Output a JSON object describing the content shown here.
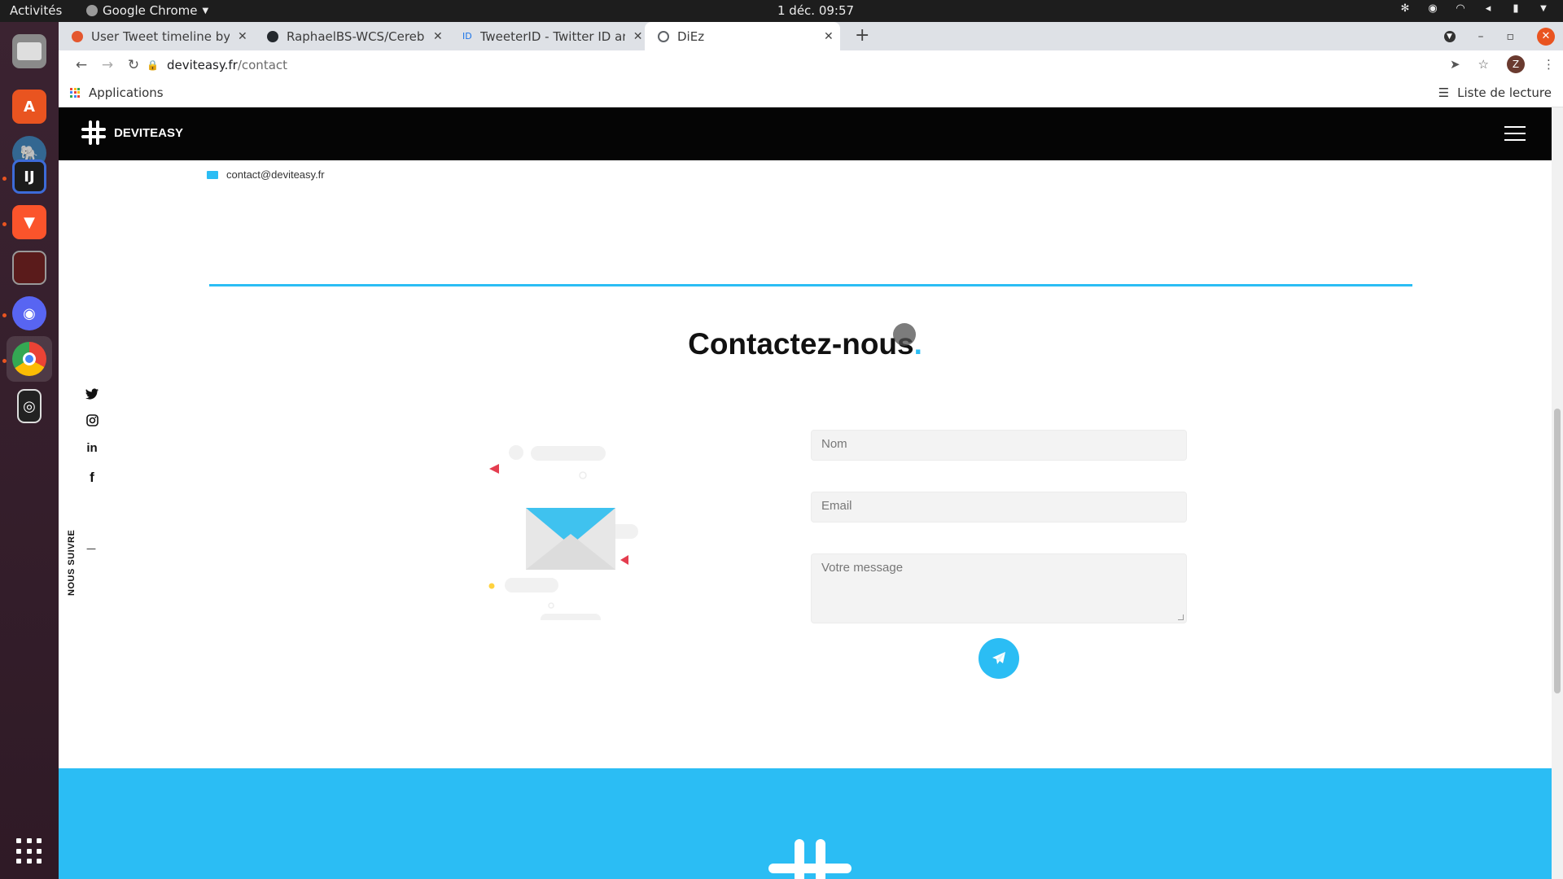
{
  "topbar": {
    "activities": "Activités",
    "app_name": "Google Chrome",
    "clock": "1 déc.  09:57"
  },
  "tabs": [
    {
      "title": "User Tweet timeline by ID",
      "favicon_color": "#e4572e"
    },
    {
      "title": "RaphaelBS-WCS/Cerebook",
      "favicon_color": "#24292e"
    },
    {
      "title": "TweeterID - Twitter ID and",
      "favicon_color": "#1a73e8",
      "favicon_text": "ID"
    },
    {
      "title": "DiEz",
      "favicon_color": "#5f6368",
      "active": true
    }
  ],
  "address": {
    "host": "deviteasy.fr",
    "path": "/contact"
  },
  "profile_initial": "Z",
  "bookmarks": {
    "apps_label": "Applications",
    "reading_list": "Liste de lecture"
  },
  "site": {
    "brand": "DEVITEASY",
    "email": "contact@deviteasy.fr",
    "title_main": "Contactez-nous",
    "title_dot": ".",
    "follow_label": "NOUS SUIVRE",
    "follow_dash": "—",
    "social_icons": [
      "twitter-icon",
      "instagram-icon",
      "linkedin-icon",
      "facebook-icon"
    ],
    "accent_color": "#2bbdf4",
    "form": {
      "name_placeholder": "Nom",
      "email_placeholder": "Email",
      "message_placeholder": "Votre message"
    }
  }
}
